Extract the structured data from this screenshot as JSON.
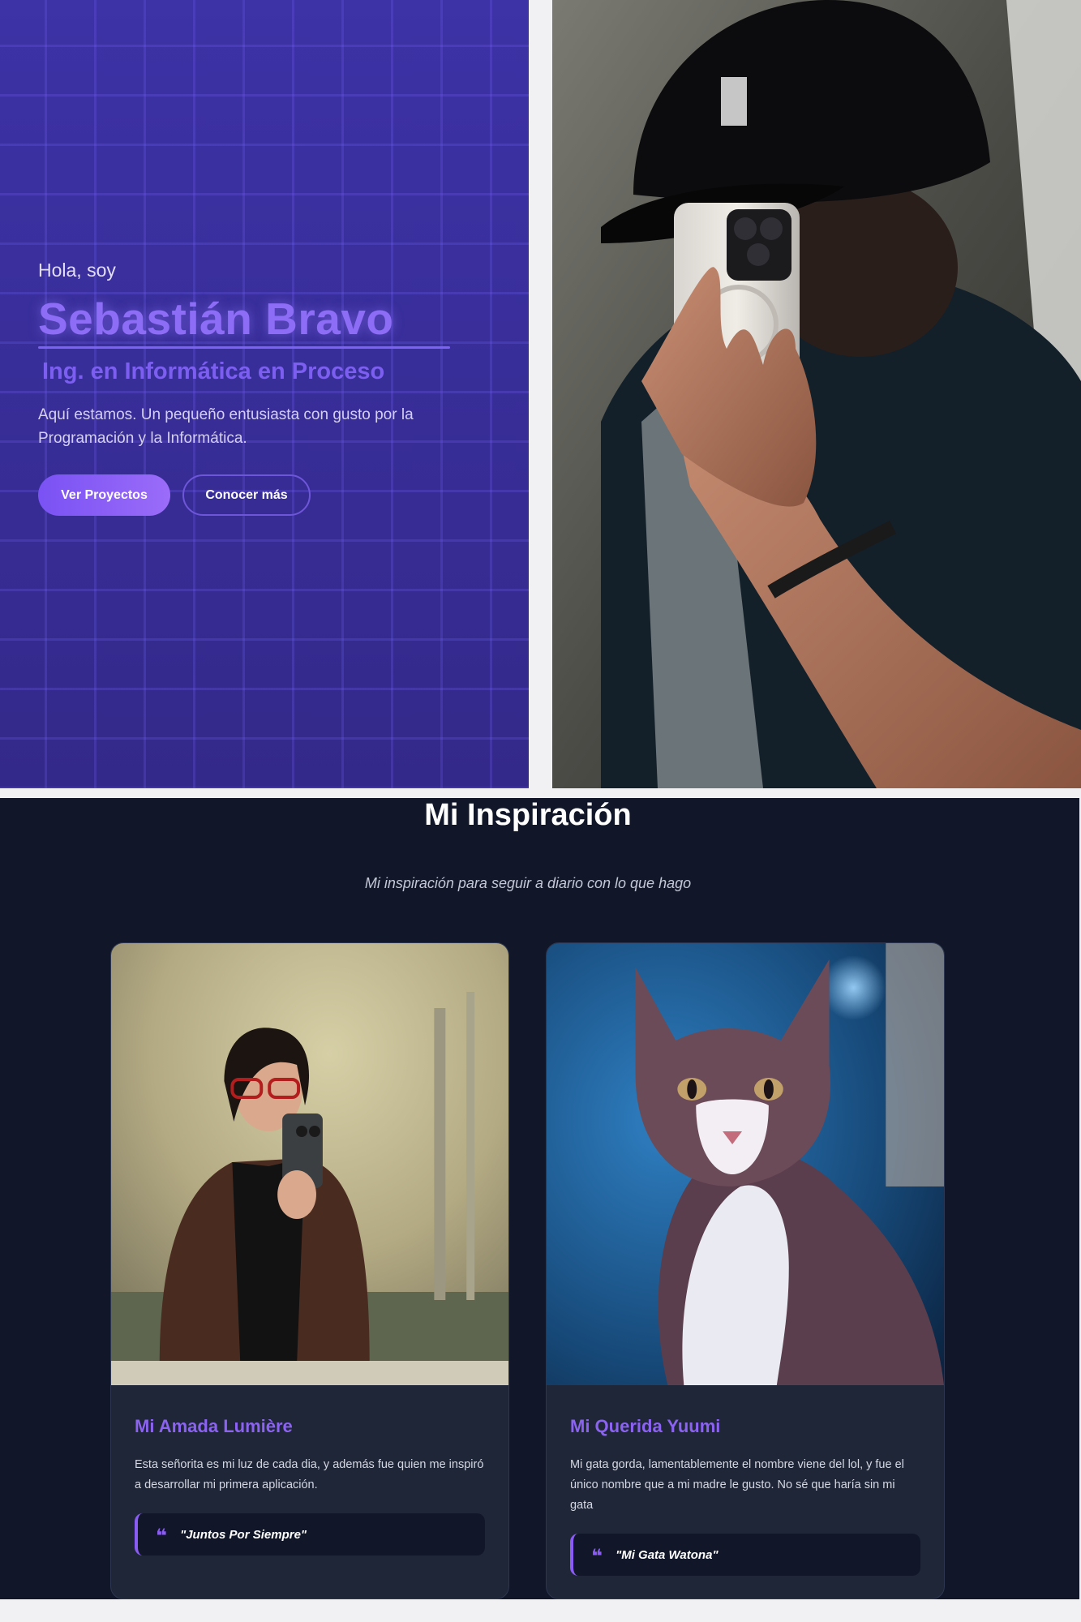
{
  "hero": {
    "greeting": "Hola, soy",
    "name": "Sebastián Bravo",
    "role": "Ing. en Informática en Proceso",
    "description": "Aquí estamos. Un pequeño entusiasta con gusto por la Programación y la Informática.",
    "primary_button": "Ver Proyectos",
    "secondary_button": "Conocer más"
  },
  "inspiration": {
    "title": "Mi Inspiración",
    "subtitle": "Mi inspiración para seguir a diario con lo que hago",
    "cards": [
      {
        "title": "Mi Amada Lumière",
        "text": "Esta señorita es mi luz de cada dia, y además fue quien me inspiró a desarrollar mi primera aplicación.",
        "quote": "\"Juntos Por Siempre\""
      },
      {
        "title": "Mi Querida Yuumi",
        "text": "Mi gata gorda, lamentablemente el nombre viene del lol, y fue el único nombre que a mi madre le gusto. No sé que haría sin mi gata",
        "quote": "\"Mi Gata Watona\""
      }
    ]
  },
  "colors": {
    "hero_bg": "#3a2f96",
    "accent": "#8a5cf3",
    "section_bg": "#111729",
    "card_bg": "#1e2638"
  }
}
